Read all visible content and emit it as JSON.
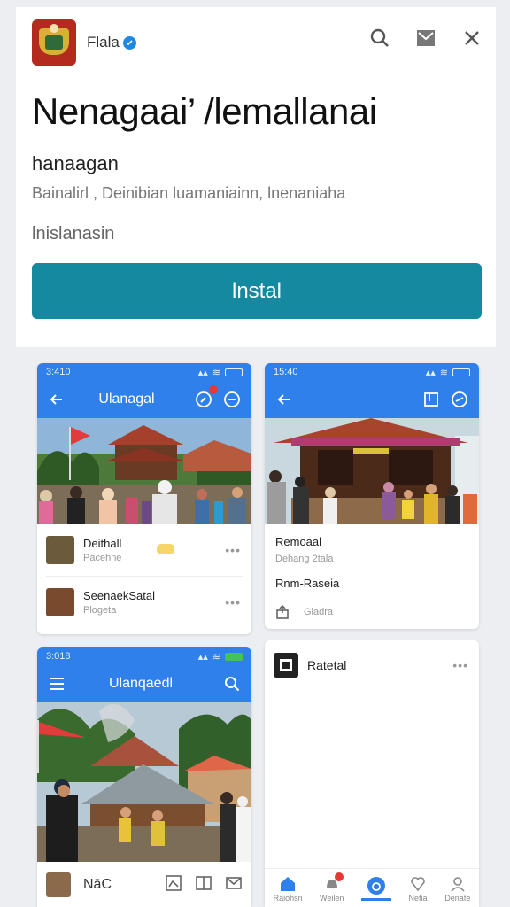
{
  "header": {
    "developer_name": "Flala",
    "icons": [
      "search-icon",
      "inbox-icon",
      "close-icon"
    ]
  },
  "app": {
    "title": "Nenagaai’ /lemallanai",
    "subtitle": "hanaagan",
    "categories": "Bainalirl , Deinibian  luamaniainn, lnenaniaha",
    "install_status": "lnislanasin",
    "install_label": "lnstal"
  },
  "colors": {
    "accent": "#14899f",
    "appbar": "#2f80ea",
    "verified": "#1e88e5"
  },
  "screenshot1": {
    "time": "3:410",
    "title": "Ulanagal",
    "items": [
      {
        "title": "Deithall",
        "sub": "Pacehne"
      },
      {
        "title": "SeenaekSatal",
        "sub": "Plogeta"
      }
    ]
  },
  "screenshot2": {
    "time": "15:40",
    "post_title": "Remoaal",
    "post_sub": "Dehang 2tala",
    "post_body": "Rnm-Raseia",
    "action": "Gladra"
  },
  "screenshot3": {
    "time": "3:018",
    "title": "Ulanqaedl",
    "bottom_label": "NāC"
  },
  "screenshot4": {
    "title": "Ratetal",
    "nav": [
      "Raiohsn",
      "Weilen",
      "",
      "Nefia",
      "Denate"
    ]
  }
}
